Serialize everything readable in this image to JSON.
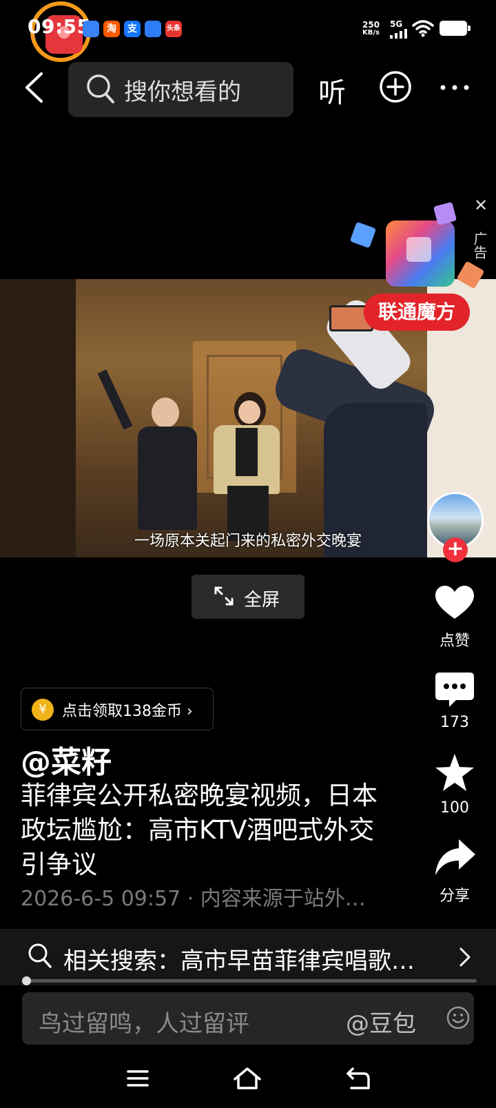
{
  "status_bar": {
    "time": "09:55",
    "app_icons": [
      {
        "name": "qq-icon",
        "color": "#3a82f7",
        "text": ""
      },
      {
        "name": "taobao-icon",
        "color": "#ff5a00",
        "text": "淘"
      },
      {
        "name": "alipay-icon",
        "color": "#1677ff",
        "text": "支"
      },
      {
        "name": "browser-icon",
        "color": "#2e7df7",
        "text": ""
      },
      {
        "name": "toutiao-icon",
        "color": "#e8352e",
        "text": "头条"
      }
    ],
    "net_speed_value": "250",
    "net_speed_unit": "KB/s",
    "network": "5G"
  },
  "top_bar": {
    "search_placeholder": "搜你想看的",
    "listen_label": "听"
  },
  "video": {
    "subtitle": "一场原本关起门来的私密外交晚宴",
    "fullscreen_label": "全屏"
  },
  "ad": {
    "label": "广告",
    "brand": "联通魔方"
  },
  "right_rail": {
    "like_label": "点赞",
    "comment_count": "173",
    "favorite_count": "100",
    "share_label": "分享"
  },
  "post": {
    "coin_text": "点击领取138金币",
    "author": "@菜籽",
    "title": "菲律宾公开私密晚宴视频，日本政坛尴尬：高市KTV酒吧式外交引争议",
    "meta": "2026-6-5 09:57 · 内容来源于站外…"
  },
  "related_search": {
    "text": "相关搜索：高市早苗菲律宾唱歌…"
  },
  "comment_bar": {
    "placeholder": "鸟过留鸣，人过留评",
    "mention": "@豆包"
  },
  "colors": {
    "accent_red": "#f0313d",
    "record_ring": "#f59a1a"
  }
}
